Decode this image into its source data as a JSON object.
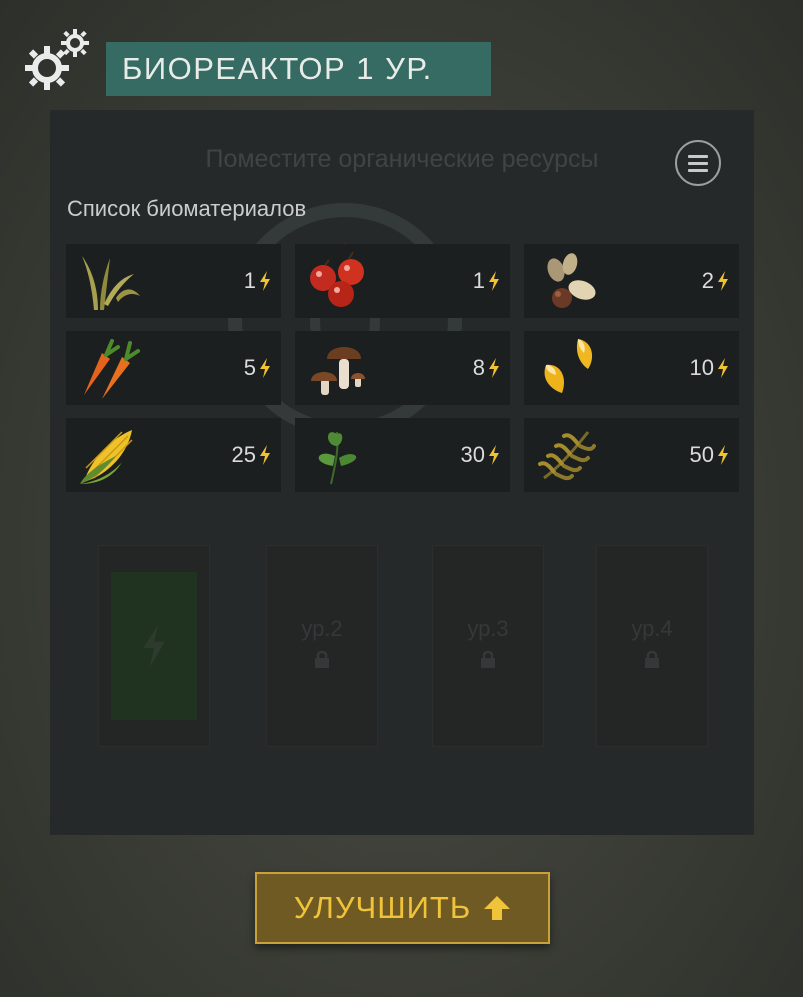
{
  "header": {
    "title": "БИОРЕАКТОР 1 УР.",
    "settings_icon": "gears-icon"
  },
  "panel": {
    "hint": "Поместите органические ресурсы",
    "menu_icon": "menu-icon",
    "list_label": "Список биоматериалов"
  },
  "biomaterials": [
    {
      "icon": "plant-fiber-icon",
      "value": "1"
    },
    {
      "icon": "berries-icon",
      "value": "1"
    },
    {
      "icon": "seeds-icon",
      "value": "2"
    },
    {
      "icon": "carrot-icon",
      "value": "5"
    },
    {
      "icon": "mushroom-icon",
      "value": "8"
    },
    {
      "icon": "corn-kernels-icon",
      "value": "10"
    },
    {
      "icon": "corn-cob-icon",
      "value": "25"
    },
    {
      "icon": "herb-leaves-icon",
      "value": "30"
    },
    {
      "icon": "fern-icon",
      "value": "50"
    }
  ],
  "slots": [
    {
      "label": "",
      "active": true,
      "icon": "lightning-icon"
    },
    {
      "label": "ур.2",
      "locked": true,
      "icon": "lock-icon"
    },
    {
      "label": "ур.3",
      "locked": true,
      "icon": "lock-icon"
    },
    {
      "label": "ур.4",
      "locked": true,
      "icon": "lock-icon"
    }
  ],
  "upgrade_button": {
    "label": "УЛУЧШИТЬ",
    "icon": "arrow-up-icon"
  },
  "colors": {
    "title_bg": "#356b63",
    "panel_bg": "#262929",
    "cell_bg": "#1c1f1f",
    "bolt": "#f2c230",
    "button_bg": "#6e5a22",
    "button_text": "#f0c43a"
  }
}
